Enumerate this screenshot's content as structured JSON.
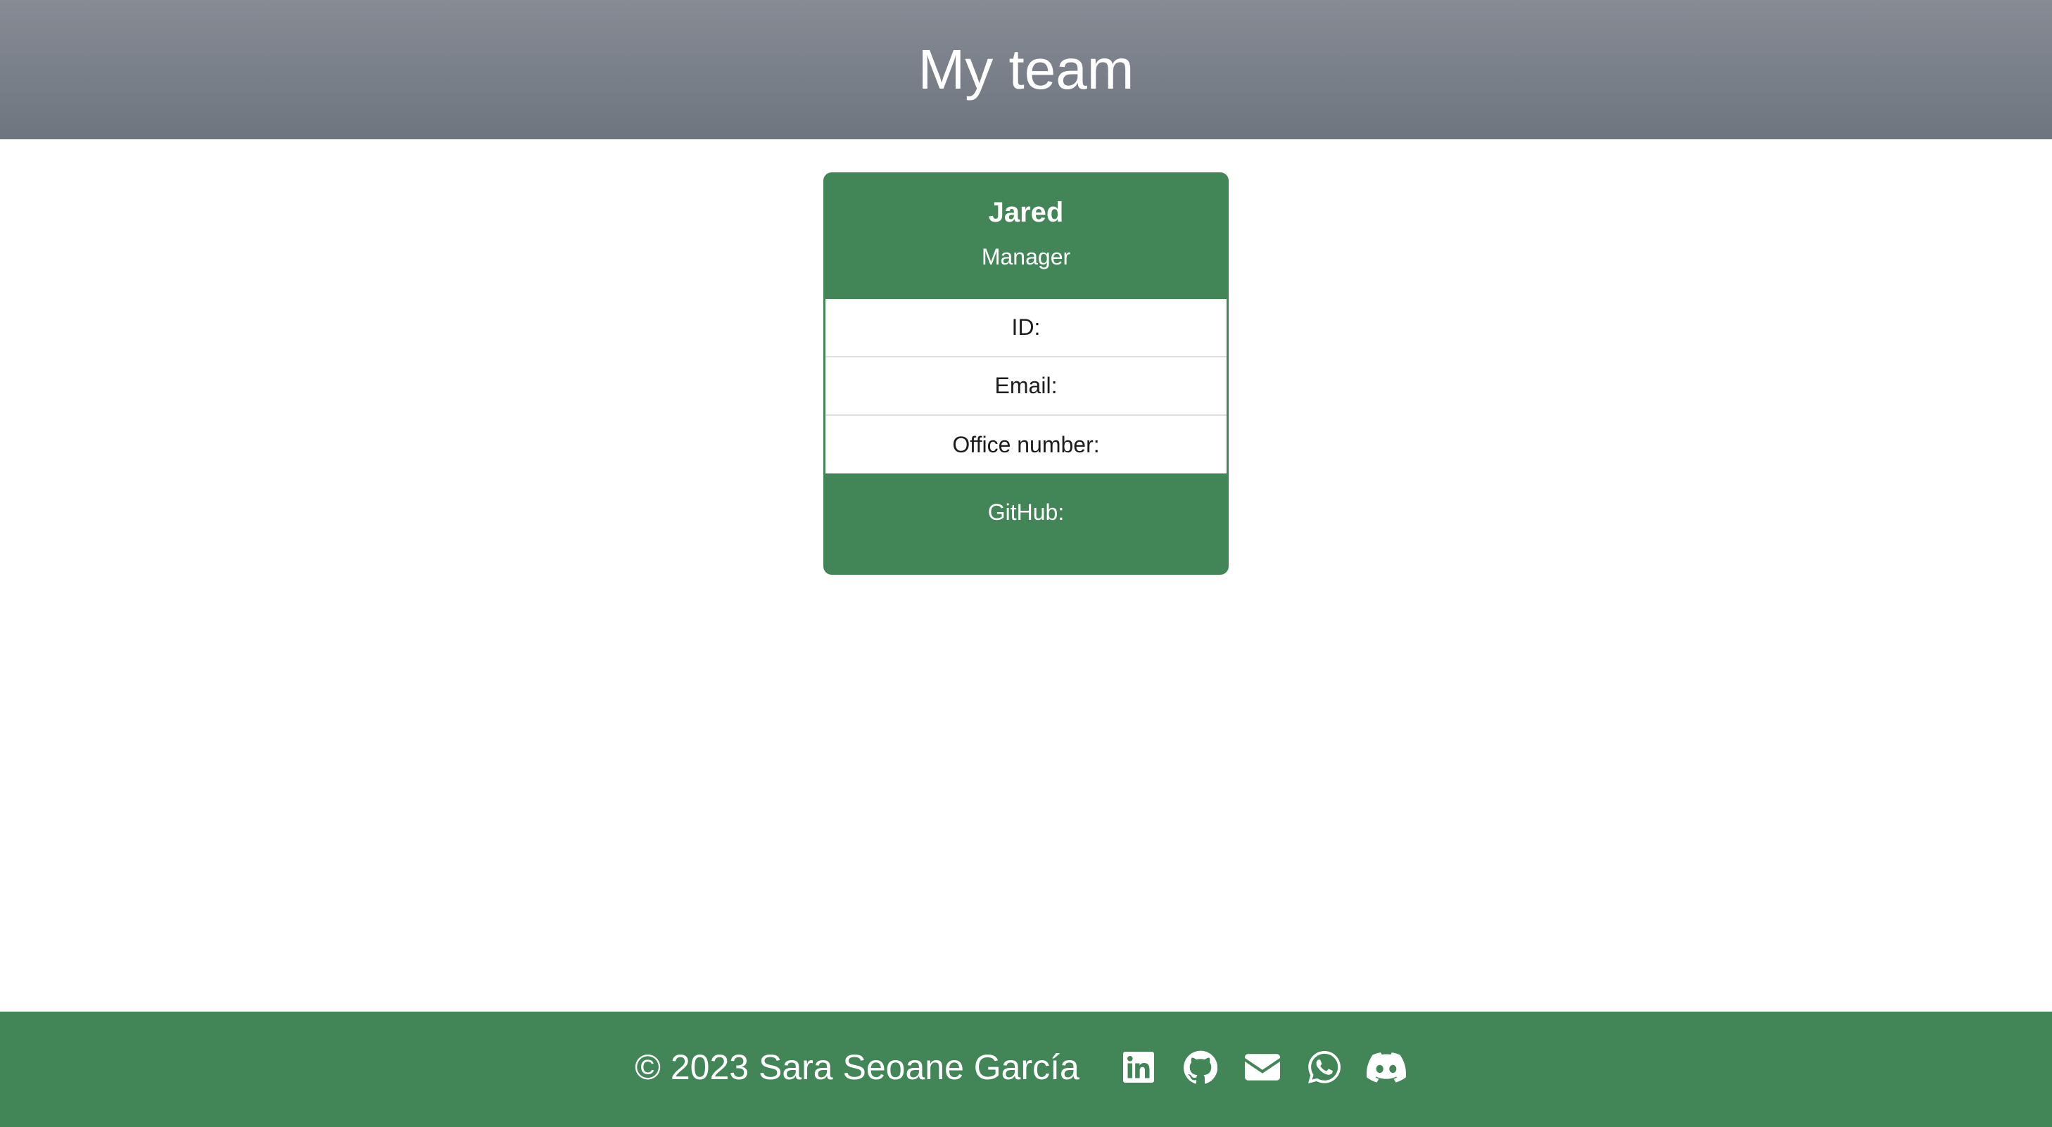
{
  "header": {
    "title": "My team"
  },
  "card": {
    "name": "Jared",
    "role": "Manager",
    "rows": [
      {
        "label": "ID:"
      },
      {
        "label": "Email:"
      },
      {
        "label": "Office number:"
      }
    ],
    "footer_label": "GitHub:"
  },
  "footer": {
    "copyright": "© 2023 Sara Seoane García",
    "icons": [
      "linkedin-icon",
      "github-icon",
      "email-icon",
      "whatsapp-icon",
      "discord-icon"
    ]
  },
  "colors": {
    "header_gradient_top": "#868b94",
    "header_gradient_bottom": "#6f757f",
    "accent_green": "#428658",
    "text_dark": "#1d1d1f"
  }
}
